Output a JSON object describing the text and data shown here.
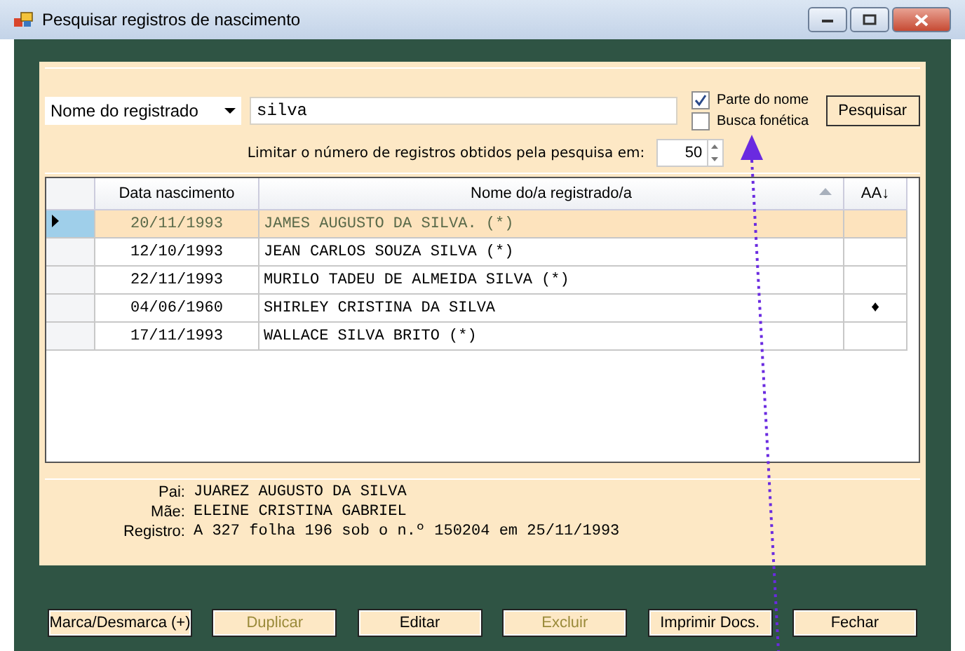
{
  "window": {
    "title": "Pesquisar registros de nascimento"
  },
  "search": {
    "field_select": "Nome do registrado",
    "value": "silva",
    "button": "Pesquisar",
    "options": [
      {
        "label": "Parte do nome",
        "checked": true
      },
      {
        "label": "Busca fonética",
        "checked": false
      }
    ],
    "limit_label": "Limitar o número de registros obtidos pela pesquisa em:",
    "limit_value": "50"
  },
  "table": {
    "columns": [
      {
        "label": "Data nascimento",
        "sorted": false
      },
      {
        "label": "Nome do/a registrado/a",
        "sorted": true
      },
      {
        "label": "AA↓",
        "sorted": false
      }
    ],
    "rows": [
      {
        "selected": true,
        "cells": [
          "20/11/1993",
          "JAMES AUGUSTO DA SILVA. (*)",
          ""
        ]
      },
      {
        "selected": false,
        "cells": [
          "12/10/1993",
          "JEAN CARLOS SOUZA SILVA (*)",
          ""
        ]
      },
      {
        "selected": false,
        "cells": [
          "22/11/1993",
          "MURILO TADEU DE ALMEIDA SILVA (*)",
          ""
        ]
      },
      {
        "selected": false,
        "cells": [
          "04/06/1960",
          "SHIRLEY CRISTINA DA SILVA",
          "♦"
        ]
      },
      {
        "selected": false,
        "cells": [
          "17/11/1993",
          "WALLACE SILVA BRITO (*)",
          ""
        ]
      }
    ]
  },
  "details": [
    {
      "label": "Pai:",
      "value": "JUAREZ AUGUSTO DA SILVA"
    },
    {
      "label": "Mãe:",
      "value": "ELEINE CRISTINA GABRIEL"
    },
    {
      "label": "Registro:",
      "value": "A 327 folha 196  sob o n.º 150204 em 25/11/1993"
    }
  ],
  "buttons": [
    {
      "label": "Marca/Desmarca (+)",
      "disabled": false
    },
    {
      "label": "Duplicar",
      "disabled": true
    },
    {
      "label": "Editar",
      "disabled": false
    },
    {
      "label": "Excluir",
      "disabled": true
    },
    {
      "label": "Imprimir Docs.",
      "disabled": false
    },
    {
      "label": "Fechar",
      "disabled": false
    }
  ]
}
